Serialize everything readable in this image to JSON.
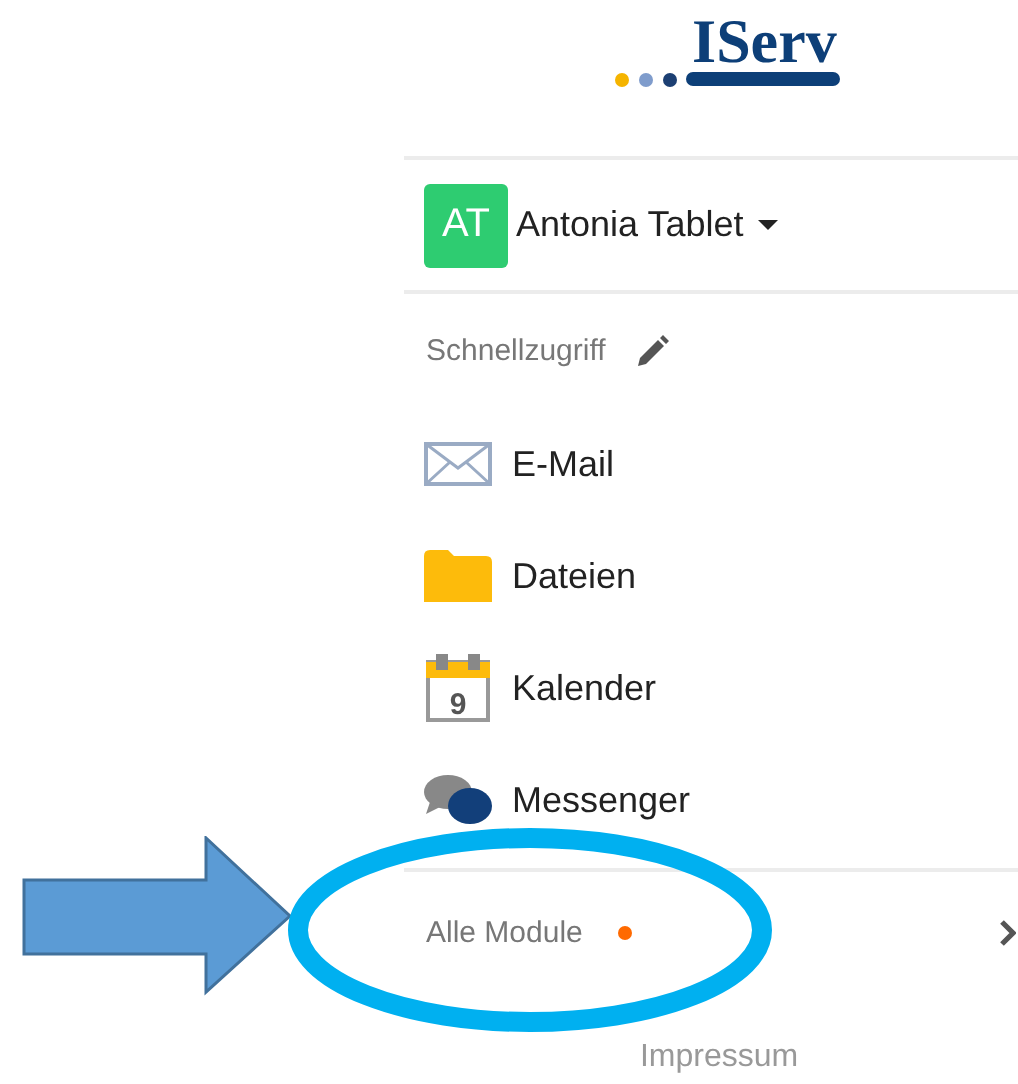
{
  "logo": {
    "text": "IServ"
  },
  "user": {
    "initials": "AT",
    "name": "Antonia Tablet"
  },
  "quick_access": {
    "label": "Schnellzugriff"
  },
  "items": [
    {
      "kind": "mail",
      "label": "E-Mail"
    },
    {
      "kind": "folder",
      "label": "Dateien"
    },
    {
      "kind": "calendar",
      "label": "Kalender",
      "day": "9"
    },
    {
      "kind": "chat",
      "label": "Messenger"
    }
  ],
  "all_modules": {
    "label": "Alle Module",
    "notification": true
  },
  "footer": {
    "link": "Impressum"
  },
  "annotations": [
    {
      "kind": "arrow"
    },
    {
      "kind": "ellipse"
    }
  ]
}
